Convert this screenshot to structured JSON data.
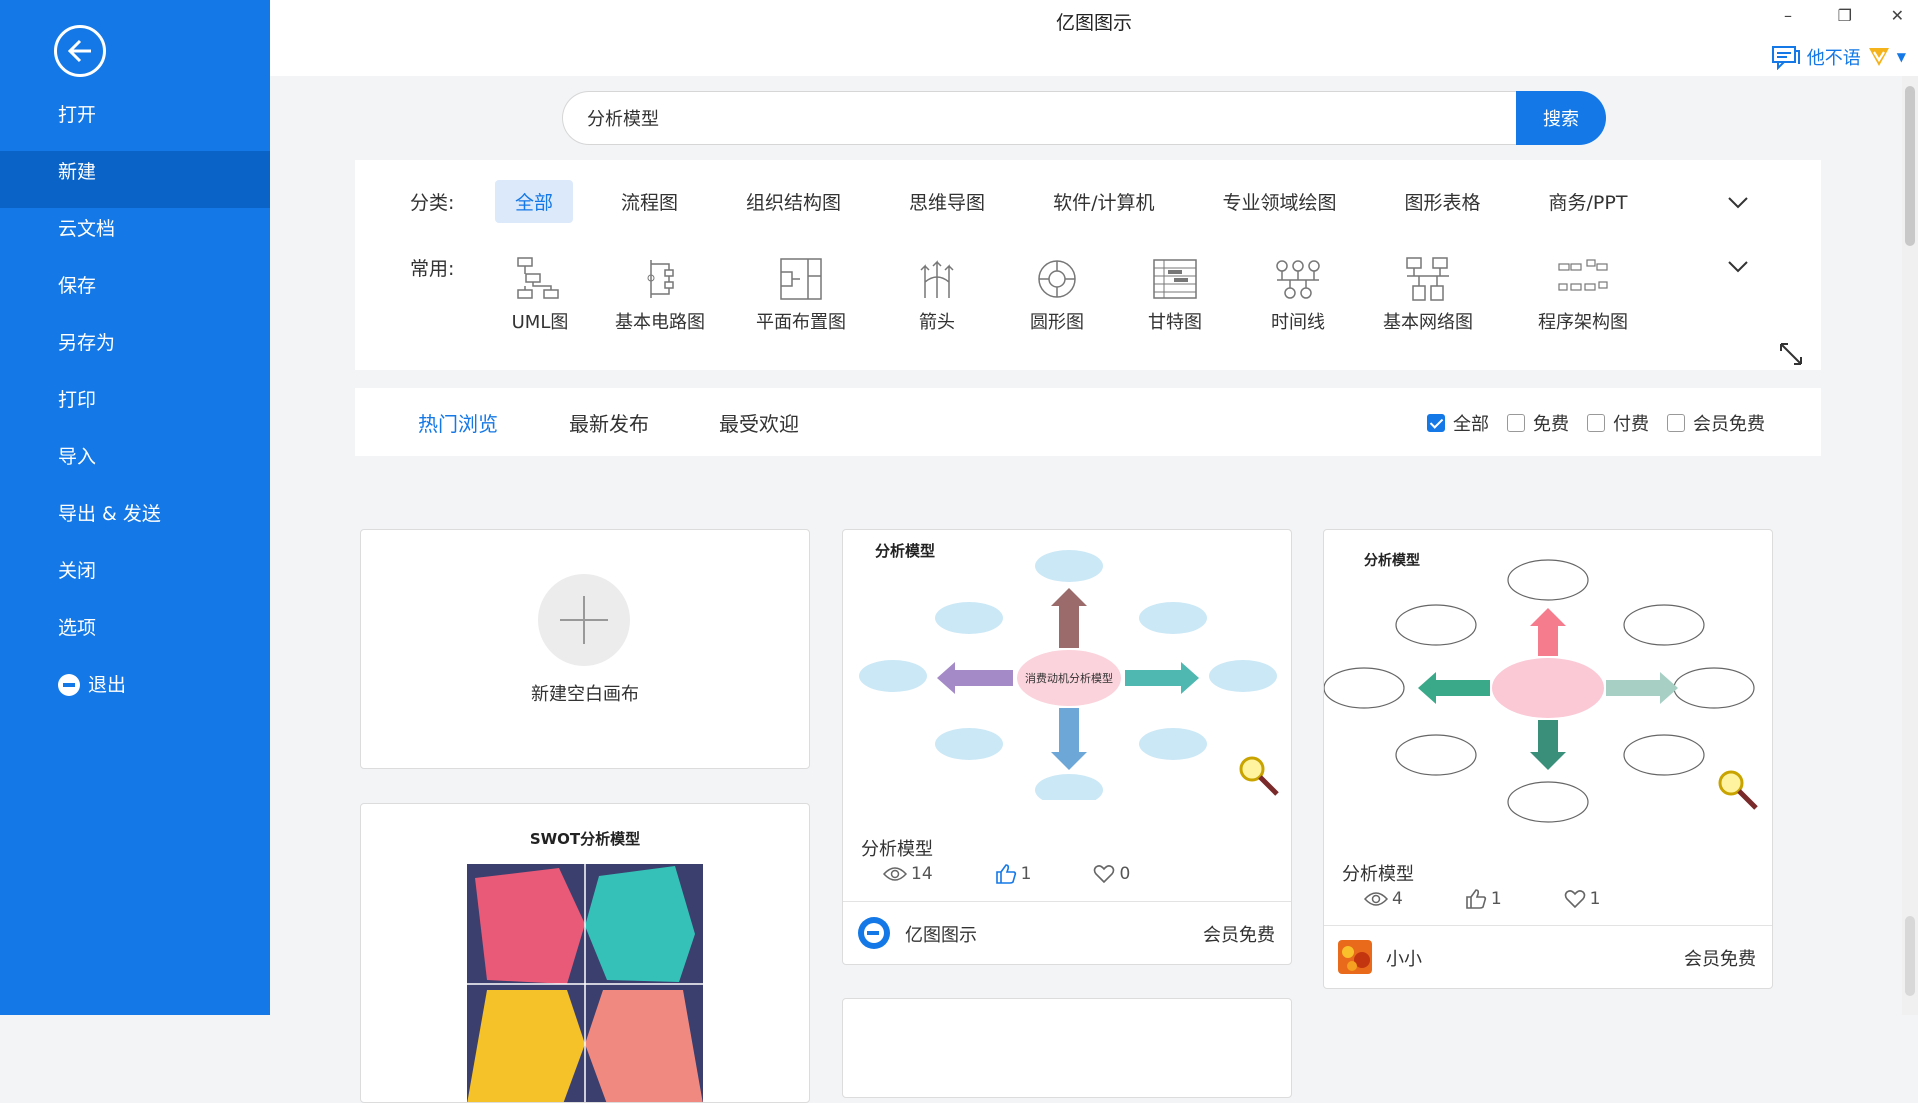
{
  "app": {
    "title": "亿图图示"
  },
  "window": {
    "minimize": "–",
    "restore": "❐",
    "close": "✕"
  },
  "user": {
    "name": "他不语"
  },
  "sidebar": {
    "items": [
      {
        "label": "打开"
      },
      {
        "label": "新建",
        "active": true
      },
      {
        "label": "云文档"
      },
      {
        "label": "保存"
      },
      {
        "label": "另存为"
      },
      {
        "label": "打印"
      },
      {
        "label": "导入"
      },
      {
        "label": "导出 & 发送"
      },
      {
        "label": "关闭"
      },
      {
        "label": "选项"
      },
      {
        "label": "退出"
      }
    ]
  },
  "search": {
    "value": "分析模型",
    "button": "搜索"
  },
  "filters": {
    "category_label": "分类:",
    "categories": [
      "全部",
      "流程图",
      "组织结构图",
      "思维导图",
      "软件/计算机",
      "专业领域绘图",
      "图形表格",
      "商务/PPT"
    ],
    "common_label": "常用:",
    "common": [
      "UML图",
      "基本电路图",
      "平面布置图",
      "箭头",
      "圆形图",
      "甘特图",
      "时间线",
      "基本网络图",
      "程序架构图"
    ]
  },
  "sort": {
    "tabs": [
      "热门浏览",
      "最新发布",
      "最受欢迎"
    ],
    "checks": [
      {
        "label": "全部",
        "checked": true
      },
      {
        "label": "免费",
        "checked": false
      },
      {
        "label": "付费",
        "checked": false
      },
      {
        "label": "会员免费",
        "checked": false
      }
    ]
  },
  "new_canvas": {
    "label": "新建空白画布"
  },
  "cards": [
    {
      "thumb_title": "分析模型",
      "center_label": "消费动机分析模型",
      "title": "分析模型",
      "views": "14",
      "likes": "1",
      "favorites": "0",
      "author": "亿图图示",
      "price": "会员免费"
    },
    {
      "thumb_title": "分析模型",
      "title": "分析模型",
      "views": "4",
      "likes": "1",
      "favorites": "1",
      "author": "小小",
      "price": "会员免费"
    },
    {
      "thumb_title": "SWOT分析模型"
    }
  ],
  "colors": {
    "accent": "#1478e6",
    "sidebar": "#1478e6",
    "sidebar_active": "#0a63c7"
  }
}
